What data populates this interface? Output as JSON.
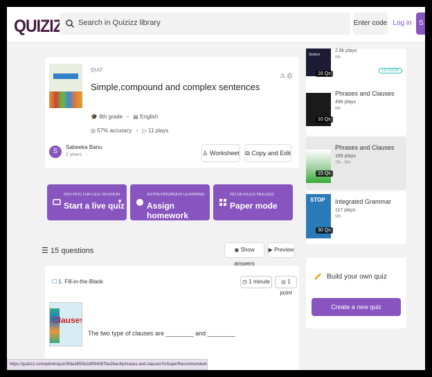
{
  "header": {
    "logo": "QUIZIZZ",
    "search_placeholder": "Search in Quizizz library",
    "enter_code": "Enter code",
    "login": "Log in",
    "signup": "S"
  },
  "quiz": {
    "type": "QUIZ",
    "title": "Simple,compound and complex sentences",
    "grade": "8th grade",
    "language": "English",
    "accuracy": "57% accuracy",
    "plays": "11 plays",
    "author": "Sabeeka Banu",
    "author_age": "2 years",
    "avatar_letter": "S",
    "worksheet": "Worksheet",
    "copy_edit": "Copy and Edit"
  },
  "actions": [
    {
      "sub": "INSTRUCTOR-LED SESSION",
      "main": "Start a live quiz"
    },
    {
      "sub": "ASYNCHRONOUS LEARNING",
      "main": "Assign homework"
    },
    {
      "sub": "NO DEVICES NEEDED",
      "main": "Paper mode"
    }
  ],
  "questions": {
    "count": "15 questions",
    "show_answers": "Show answers",
    "preview": "Preview",
    "q1_label": "1. Fill-in-the-Blank",
    "q1_time": "1 minute",
    "q1_points": "1 point",
    "q1_image_text": "Clauses",
    "q1_text": "The two type of clauses are ________ and ________"
  },
  "recommended": [
    {
      "plays": "2.8k plays",
      "grade": "6th",
      "badge": "16 Qs",
      "tag": "LESSON",
      "thumb_text": "Quizizz"
    },
    {
      "title": "Phrases and Clauses",
      "plays": "498 plays",
      "grade": "6th",
      "badge": "10 Qs"
    },
    {
      "title": "Phrases and Clauses",
      "plays": "169 plays",
      "grade": "7th - 9th",
      "badge": "15 Qs"
    },
    {
      "title": "Integrated Grammar",
      "plays": "117 plays",
      "grade": "5th",
      "badge": "30 Qs",
      "thumb_text": "STOP"
    }
  ],
  "build": {
    "title": "Build your own quiz",
    "button": "Create a new quiz"
  },
  "status_url": "https://quizizz.com/admin/quiz/5fda3655b2df994087be28ac4/phrases-and-clauses?isSuperRecommended=false",
  "colors": {
    "brand": "#8854c0",
    "logo": "#461a42"
  }
}
